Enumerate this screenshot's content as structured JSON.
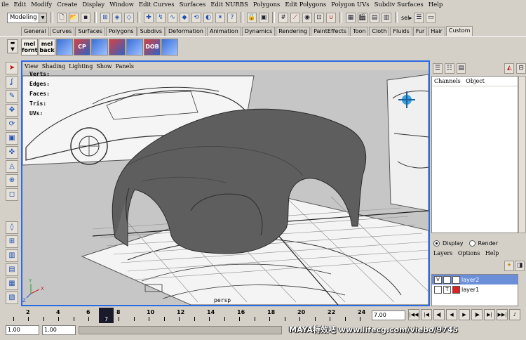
{
  "menubar": [
    "ile",
    "Edit",
    "Modify",
    "Create",
    "Display",
    "Window",
    "Edit Curves",
    "Surfaces",
    "Edit NURBS",
    "Polygons",
    "Edit Polygons",
    "Polygon UVs",
    "Subdiv Surfaces",
    "Help"
  ],
  "status": {
    "mode": "Modeling",
    "sel_label": "sel▸"
  },
  "shelf_tabs": [
    "General",
    "Curves",
    "Surfaces",
    "Polygons",
    "Subdivs",
    "Deformation",
    "Animation",
    "Dynamics",
    "Rendering",
    "PaintEffects",
    "Toon",
    "Cloth",
    "Fluids",
    "Fur",
    "Hair",
    "Custom"
  ],
  "shelf_active": "Custom",
  "shelf_buttons": [
    {
      "line1": "mel",
      "line2": "fornt"
    },
    {
      "line1": "mel",
      "line2": "back"
    },
    {
      "line1": "",
      "line2": ""
    },
    {
      "line1": "",
      "line2": "CP"
    },
    {
      "line1": "",
      "line2": ""
    },
    {
      "line1": "",
      "line2": ""
    },
    {
      "line1": "",
      "line2": ""
    },
    {
      "line1": "",
      "line2": "DOB"
    },
    {
      "line1": "",
      "line2": ""
    }
  ],
  "viewport": {
    "menu": [
      "View",
      "Shading",
      "Lighting",
      "Show",
      "Panels"
    ],
    "hud": [
      "Verts:",
      "Edges:",
      "Faces:",
      "Tris:",
      "UVs:"
    ],
    "camera": "persp",
    "axis": {
      "x": "X",
      "y": "Y",
      "z": "Z"
    }
  },
  "channel_box": {
    "tabs": [
      "Channels",
      "Object"
    ]
  },
  "display_render": {
    "display": "Display",
    "render": "Render",
    "selected": "Display"
  },
  "layers": {
    "menu": [
      "Layers",
      "Options",
      "Help"
    ],
    "items": [
      {
        "vis": "V",
        "type": "",
        "name": "layer2",
        "color": "#ffffff",
        "selected": true
      },
      {
        "vis": "",
        "type": "T",
        "name": "layer1",
        "color": "#e02020",
        "selected": false
      }
    ]
  },
  "timeline": {
    "ticks": [
      "2",
      "4",
      "6",
      "8",
      "10",
      "12",
      "14",
      "16",
      "18",
      "20",
      "22",
      "24"
    ],
    "current_frame": "7",
    "current_time": "7.00"
  },
  "range": {
    "start": "1.00",
    "end": "1.00"
  },
  "watermark": "MAYA特效吧   www.lifecg.com/viebo/9745"
}
